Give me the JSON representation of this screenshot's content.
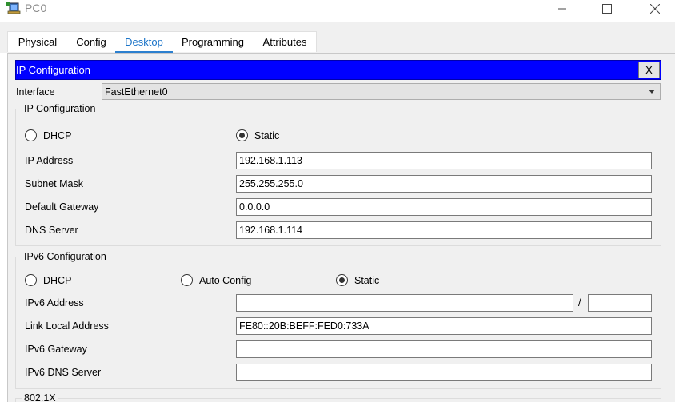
{
  "window": {
    "title": "PC0"
  },
  "tabs": [
    {
      "label": "Physical"
    },
    {
      "label": "Config"
    },
    {
      "label": "Desktop"
    },
    {
      "label": "Programming"
    },
    {
      "label": "Attributes"
    }
  ],
  "active_tab": "Desktop",
  "panel": {
    "title": "IP Configuration",
    "close_label": "X"
  },
  "interface": {
    "label": "Interface",
    "value": "FastEthernet0"
  },
  "ipv4": {
    "group_title": "IP Configuration",
    "dhcp_label": "DHCP",
    "static_label": "Static",
    "mode": "Static",
    "ip_address": {
      "label": "IP Address",
      "value": "192.168.1.113"
    },
    "subnet_mask": {
      "label": "Subnet Mask",
      "value": "255.255.255.0"
    },
    "default_gateway": {
      "label": "Default Gateway",
      "value": "0.0.0.0"
    },
    "dns_server": {
      "label": "DNS Server",
      "value": "192.168.1.114"
    }
  },
  "ipv6": {
    "group_title": "IPv6 Configuration",
    "dhcp_label": "DHCP",
    "auto_label": "Auto Config",
    "static_label": "Static",
    "mode": "Static",
    "ipv6_address": {
      "label": "IPv6 Address",
      "value": "",
      "prefix_sep": "/",
      "prefix": ""
    },
    "link_local": {
      "label": "Link Local Address",
      "value": "FE80::20B:BEFF:FED0:733A"
    },
    "ipv6_gateway": {
      "label": "IPv6 Gateway",
      "value": ""
    },
    "ipv6_dns": {
      "label": "IPv6 DNS Server",
      "value": ""
    }
  },
  "dot1x": {
    "group_title": "802.1X"
  },
  "colors": {
    "header": "#0000ff",
    "active_tab": "#1b74c8",
    "background": "#f0f0f0"
  }
}
